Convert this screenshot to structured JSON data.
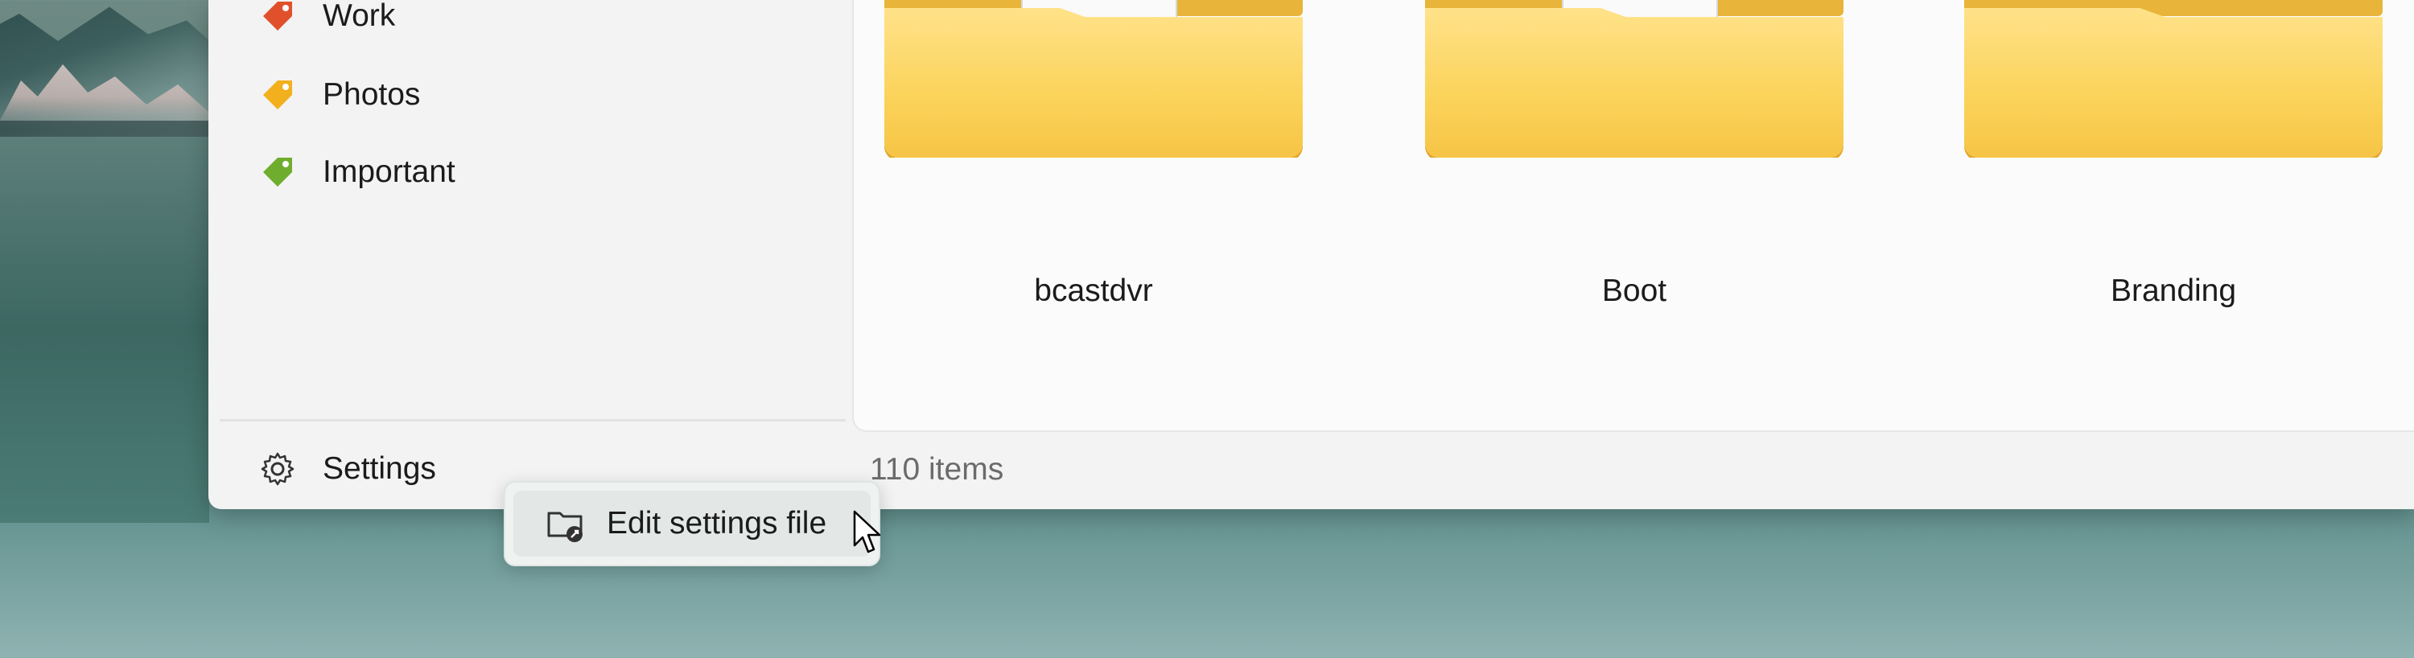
{
  "sidebar": {
    "tags": [
      {
        "label": "Work",
        "color": "#e0512b",
        "icon": "tag-icon"
      },
      {
        "label": "Photos",
        "color": "#f2b01e",
        "icon": "tag-icon"
      },
      {
        "label": "Important",
        "color": "#6fad2f",
        "icon": "tag-icon"
      }
    ],
    "settings_label": "Settings"
  },
  "folders": [
    {
      "name": "bcastdvr"
    },
    {
      "name": "Boot"
    },
    {
      "name": "Branding"
    }
  ],
  "status": {
    "item_count": "110 items"
  },
  "flyout": {
    "edit_settings_label": "Edit settings file"
  }
}
